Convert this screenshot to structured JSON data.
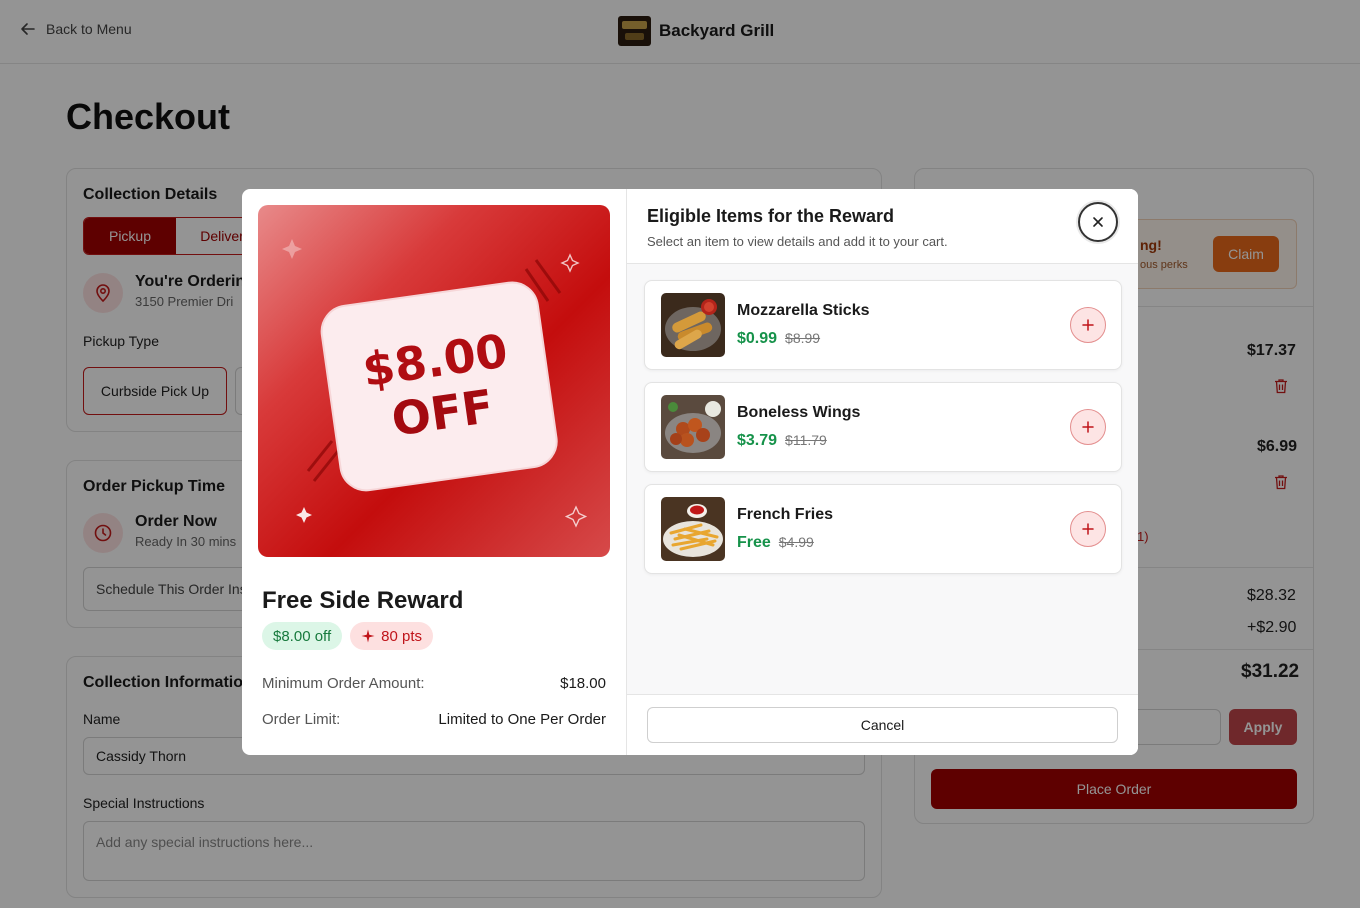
{
  "header": {
    "back_label": "Back to Menu",
    "brand_name": "Backyard Grill"
  },
  "page": {
    "title": "Checkout"
  },
  "collection_details": {
    "title": "Collection Details",
    "tabs": [
      "Pickup",
      "Deliver"
    ],
    "location_title": "You're Orderin",
    "location_address": "3150 Premier Dri",
    "pickup_type_label": "Pickup Type",
    "pickup_option": "Curbside Pick Up"
  },
  "pickup_time": {
    "title": "Order Pickup Time",
    "option_title": "Order Now",
    "option_sub": "Ready In 30 mins",
    "schedule_label": "Schedule This Order Ins"
  },
  "collection_info": {
    "title": "Collection Information",
    "name_label": "Name",
    "name_value": "Cassidy Thorn",
    "instructions_label": "Special Instructions",
    "instructions_placeholder": "Add any special instructions here..."
  },
  "order_summary": {
    "promo_text": "ng!",
    "promo_sub": "ous perks",
    "claim_label": "Claim",
    "item_prices": [
      "$17.37",
      "$6.99"
    ],
    "note": "1)",
    "subtotal": "$28.32",
    "fee": "+$2.90",
    "total": "$31.22",
    "apply_label": "Apply",
    "place_order_label": "Place Order"
  },
  "modal": {
    "hero_amount": "$8.00",
    "hero_off": "OFF",
    "reward_title": "Free Side Reward",
    "badge_discount": "$8.00 off",
    "badge_points": "80 pts",
    "min_order_label": "Minimum Order Amount:",
    "min_order_value": "$18.00",
    "order_limit_label": "Order Limit:",
    "order_limit_value": "Limited to One Per Order",
    "list_title": "Eligible Items for the Reward",
    "list_subtitle": "Select an item to view details and add it to your cart.",
    "cancel_label": "Cancel",
    "items": [
      {
        "name": "Mozzarella Sticks",
        "price": "$0.99",
        "original": "$8.99"
      },
      {
        "name": "Boneless Wings",
        "price": "$3.79",
        "original": "$11.79"
      },
      {
        "name": "French Fries",
        "price": "Free",
        "original": "$4.99"
      }
    ]
  },
  "colors": {
    "brand_red": "#a30000",
    "price_green": "#16924a",
    "claim_orange": "#ea6a1a"
  },
  "icons": [
    "arrow-left-icon",
    "map-pin-icon",
    "clock-icon",
    "trash-icon",
    "close-icon",
    "plus-icon",
    "sparkle-icon"
  ]
}
